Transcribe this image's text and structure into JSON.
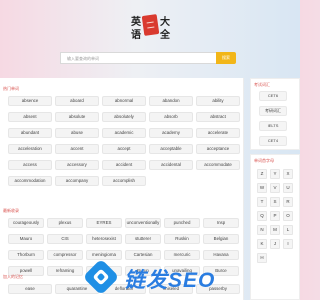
{
  "logo": {
    "chars": [
      "英",
      "语",
      "大",
      "全"
    ],
    "seal_text": "单词"
  },
  "search": {
    "placeholder": "输入要查询的单词",
    "button_label": "搜索"
  },
  "sections": [
    {
      "title": "热门单词",
      "rows": [
        [
          "absence",
          "aboard",
          "abnormal",
          "abandon",
          "ability"
        ],
        [
          "absent",
          "absolute",
          "absolutely",
          "absorb",
          "abstract"
        ],
        [
          "abundant",
          "abuse",
          "academic",
          "academy",
          "accelerate"
        ],
        [
          "acceleration",
          "accent",
          "accept",
          "acceptable",
          "acceptance"
        ],
        [
          "access",
          "accessory",
          "accident",
          "accidental",
          "accommodate"
        ],
        [
          "accommodation",
          "accompany",
          "accomplish"
        ]
      ]
    },
    {
      "title": "最新收录",
      "rows": [
        [
          "courageously",
          "plexus",
          "EYRES",
          "unconventionally",
          "punched",
          "Insp"
        ],
        [
          "Mauro",
          "CIS",
          "heterosexist",
          "stutterer",
          "Ruskin",
          "Belgian"
        ],
        [
          "Thorburn",
          "compressor",
          "meningioma",
          "Cartesian",
          "mercuric",
          "Havana"
        ],
        [
          "powell",
          "reframing",
          "ashtar",
          "Burun",
          "unavailing",
          "Burce"
        ]
      ]
    },
    {
      "title": "加入的记忆",
      "rows": [
        [
          "ease",
          "quarantine",
          "deflorator",
          "chiseled",
          "passerby"
        ]
      ]
    }
  ],
  "exam_box": {
    "title": "考试词汇",
    "items": [
      "CET6",
      "考研词汇",
      "IELTS",
      "CET4"
    ]
  },
  "letter_box": {
    "title": "单词首字母",
    "letters": [
      "Z",
      "Y",
      "X",
      "W",
      "V",
      "U",
      "T",
      "S",
      "R",
      "Q",
      "P",
      "O",
      "N",
      "M",
      "L",
      "K",
      "J",
      "I",
      "H"
    ]
  },
  "watermark": {
    "text": "链发SEO"
  }
}
